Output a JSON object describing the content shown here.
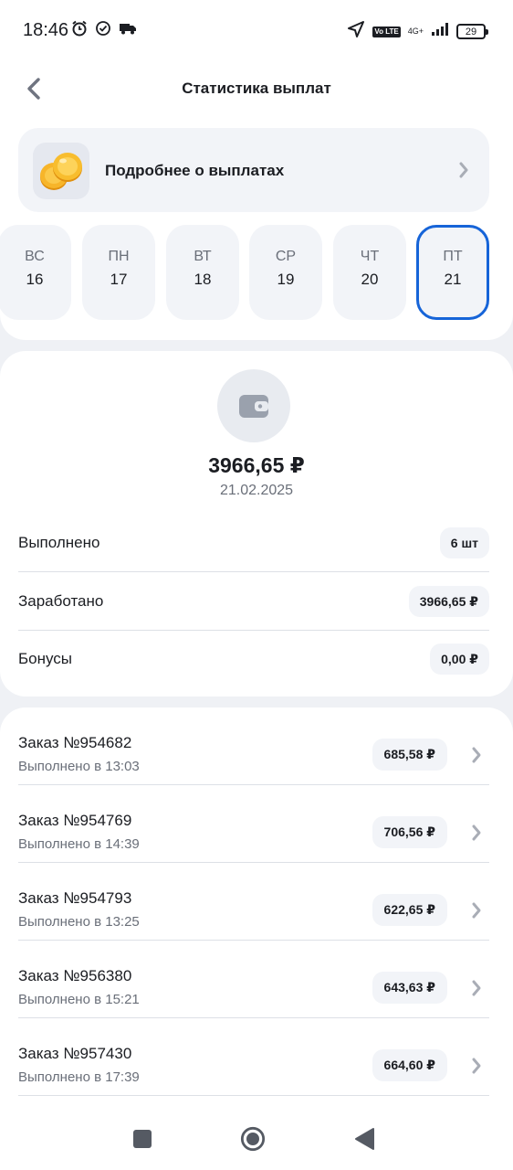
{
  "status_bar": {
    "time": "18:46",
    "network_label": "4G+",
    "volte_label": "Vo LTE",
    "battery": "29"
  },
  "header": {
    "title": "Статистика выплат",
    "back_icon": "chevron-left-icon"
  },
  "info_card": {
    "label": "Подробнее о выплатах",
    "icon": "coins-icon"
  },
  "days": [
    {
      "name": "ВС",
      "num": "16",
      "active": false
    },
    {
      "name": "ПН",
      "num": "17",
      "active": false
    },
    {
      "name": "ВТ",
      "num": "18",
      "active": false
    },
    {
      "name": "СР",
      "num": "19",
      "active": false
    },
    {
      "name": "ЧТ",
      "num": "20",
      "active": false
    },
    {
      "name": "ПТ",
      "num": "21",
      "active": true
    }
  ],
  "summary": {
    "amount": "3966,65 ₽",
    "date": "21.02.2025",
    "rows": [
      {
        "label": "Выполнено",
        "value": "6 шт"
      },
      {
        "label": "Заработано",
        "value": "3966,65 ₽"
      },
      {
        "label": "Бонусы",
        "value": "0,00 ₽"
      }
    ]
  },
  "orders": [
    {
      "title": "Заказ №954682",
      "subtitle": "Выполнено в 13:03",
      "amount": "685,58 ₽"
    },
    {
      "title": "Заказ №954769",
      "subtitle": "Выполнено в 14:39",
      "amount": "706,56 ₽"
    },
    {
      "title": "Заказ №954793",
      "subtitle": "Выполнено в 13:25",
      "amount": "622,65 ₽"
    },
    {
      "title": "Заказ №956380",
      "subtitle": "Выполнено в 15:21",
      "amount": "643,63 ₽"
    },
    {
      "title": "Заказ №957430",
      "subtitle": "Выполнено в 17:39",
      "amount": "664,60 ₽"
    }
  ],
  "colors": {
    "accent": "#1664d8",
    "background": "#eff1f5",
    "card": "#f2f4f8",
    "text": "#1b1d22",
    "muted": "#6a6f79"
  }
}
